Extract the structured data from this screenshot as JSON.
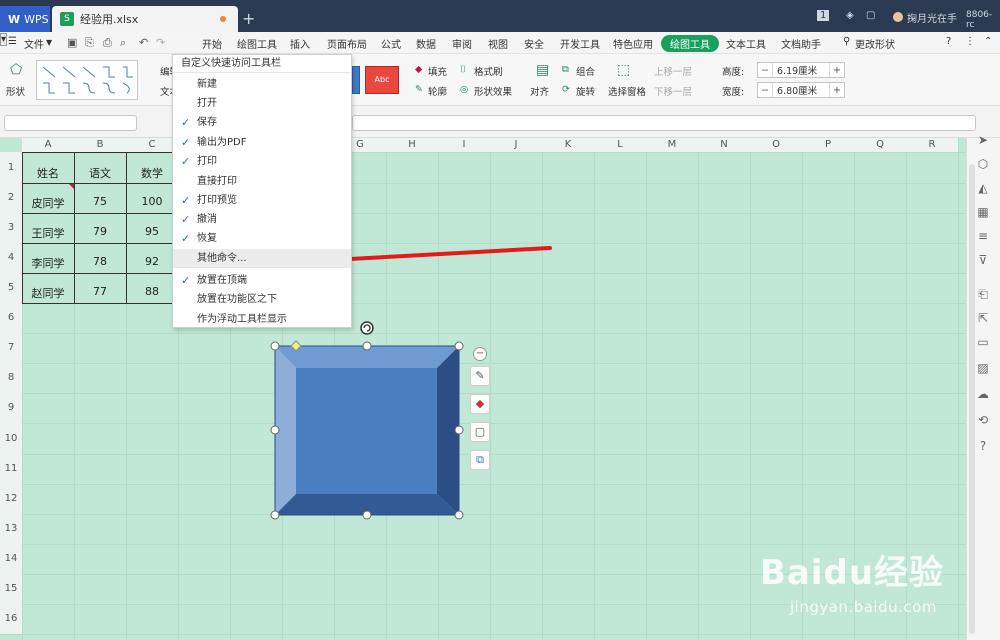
{
  "titlebar": {
    "wps_label": "WPS",
    "file_badge": "S",
    "file_name": "经验用.xlsx",
    "add_tab": "+",
    "page_num": "1",
    "user_name": "掬月光在手",
    "version": "8806-rc"
  },
  "menubar": {
    "file_label": "文件",
    "items": [
      "开始",
      "绘图工具",
      "插入",
      "页面布局",
      "公式",
      "数据",
      "审阅",
      "视图",
      "安全",
      "开发工具",
      "特色应用"
    ],
    "active": "绘图工具",
    "text_tool": "文本工具",
    "doc_helper": "文档助手",
    "search_label": "更改形状"
  },
  "ribbon": {
    "shape_label": "形状",
    "edit_label": "编辑",
    "text_label": "文本",
    "swatch_text": "Abc",
    "fill": "填充",
    "format_brush": "格式刷",
    "outline": "轮廓",
    "shape_effect": "形状效果",
    "align": "对齐",
    "group": "组合",
    "rotate": "旋转",
    "select_pane": "选择窗格",
    "bring_forward": "上移一层",
    "send_backward": "下移一层",
    "height_label": "高度:",
    "height_value": "6.19厘米",
    "width_label": "宽度:",
    "width_value": "6.80厘米"
  },
  "sheet": {
    "columns": [
      "A",
      "B",
      "C",
      "D",
      "E",
      "F",
      "G",
      "H",
      "I",
      "J",
      "K",
      "L",
      "M",
      "N",
      "O",
      "P",
      "Q",
      "R"
    ],
    "rows": [
      "1",
      "2",
      "3",
      "4",
      "5",
      "6",
      "7",
      "8",
      "9",
      "10",
      "11",
      "12",
      "13",
      "14",
      "15",
      "16"
    ],
    "headers": [
      "姓名",
      "语文",
      "数学"
    ],
    "data": [
      [
        "皮同学",
        "75",
        "100"
      ],
      [
        "王同学",
        "79",
        "95"
      ],
      [
        "李同学",
        "78",
        "92"
      ],
      [
        "赵同学",
        "77",
        "88"
      ]
    ]
  },
  "qa_menu": {
    "title": "自定义快速访问工具栏",
    "items": [
      {
        "label": "新建",
        "checked": false
      },
      {
        "label": "打开",
        "checked": false
      },
      {
        "label": "保存",
        "checked": true
      },
      {
        "label": "输出为PDF",
        "checked": true
      },
      {
        "label": "打印",
        "checked": true
      },
      {
        "label": "直接打印",
        "checked": false
      },
      {
        "label": "打印预览",
        "checked": true
      },
      {
        "label": "撤消",
        "checked": true
      },
      {
        "label": "恢复",
        "checked": true
      },
      {
        "label": "其他命令...",
        "checked": false
      },
      {
        "label": "放置在顶端",
        "checked": true
      },
      {
        "label": "放置在功能区之下",
        "checked": false
      },
      {
        "label": "作为浮动工具栏显示",
        "checked": false
      }
    ],
    "hover_index": 9
  },
  "shape": {
    "face_color": "#4a7fc1",
    "top_bevel": "#6f9bd2",
    "left_bevel": "#8daedb",
    "right_bevel": "#2d4e84",
    "bottom_bevel": "#335a93"
  },
  "annotation_color": "#e41b1b",
  "grid_color": "#c1e8d7",
  "accent_color": "#19a05c",
  "watermark": {
    "logo": "Baidu经验",
    "url": "jingyan.baidu.com"
  }
}
